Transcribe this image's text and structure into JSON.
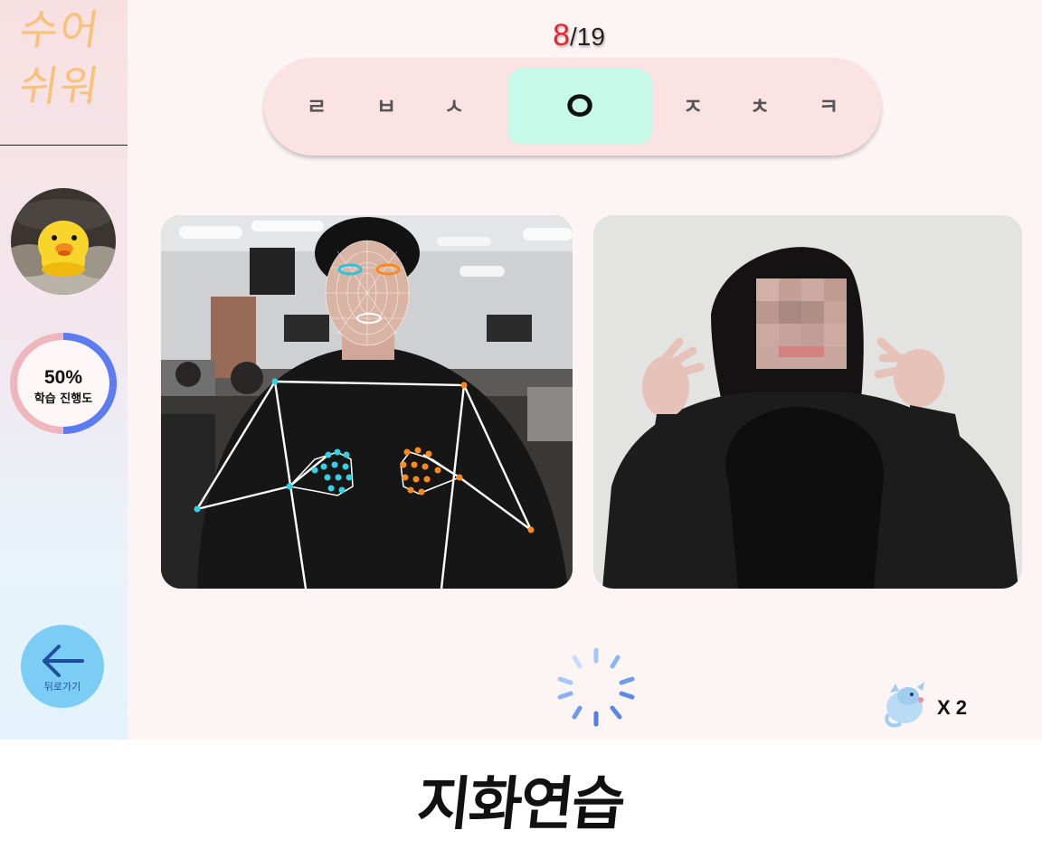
{
  "app": {
    "logo_line1": "수어",
    "logo_line2": "쉬워"
  },
  "progress": {
    "percent_text": "50%",
    "percent_value": 50,
    "label": "학습 진행도"
  },
  "back_button": {
    "label": "뒤로가기",
    "icon": "arrow-left-icon"
  },
  "counter": {
    "current": "8",
    "total": "/19"
  },
  "letters": [
    {
      "char": "ㄹ",
      "active": false
    },
    {
      "char": "ㅂ",
      "active": false
    },
    {
      "char": "ㅅ",
      "active": false
    },
    {
      "char": "ㅇ",
      "active": true
    },
    {
      "char": "ㅈ",
      "active": false
    },
    {
      "char": "ㅊ",
      "active": false
    },
    {
      "char": "ㅋ",
      "active": false
    }
  ],
  "lives": {
    "icon": "dragon-icon",
    "count": "X 2"
  },
  "caption": "지화연습",
  "colors": {
    "active_letter_bg": "#c6f9e7",
    "letter_bar_bg": "#fbe3e3",
    "progress_arc": "#5b7cf2",
    "progress_track": "#f0b6bd",
    "back_button_bg": "#7ccdf5",
    "counter_current": "#e5252a"
  }
}
